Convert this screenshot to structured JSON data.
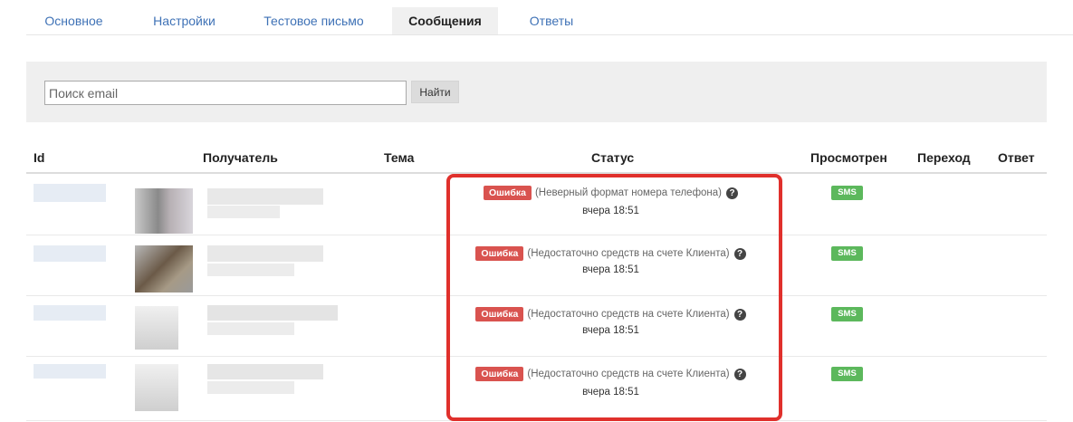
{
  "tabs": [
    {
      "label": "Основное"
    },
    {
      "label": "Настройки"
    },
    {
      "label": "Тестовое письмо"
    },
    {
      "label": "Сообщения",
      "active": true
    },
    {
      "label": "Ответы"
    }
  ],
  "search": {
    "placeholder": "Поиск email",
    "value": "",
    "button_label": "Найти"
  },
  "table": {
    "headers": {
      "id": "Id",
      "recipient": "Получатель",
      "subject": "Тема",
      "status": "Статус",
      "viewed": "Просмотрен",
      "click": "Переход",
      "reply": "Ответ"
    },
    "rows": [
      {
        "error_label": "Ошибка",
        "reason": "(Неверный формат номера телефона)",
        "time": "вчера 18:51",
        "viewed_badge": "SMS"
      },
      {
        "error_label": "Ошибка",
        "reason": "(Недостаточно средств на счете Клиента)",
        "time": "вчера 18:51",
        "viewed_badge": "SMS"
      },
      {
        "error_label": "Ошибка",
        "reason": "(Недостаточно средств на счете Клиента)",
        "time": "вчера 18:51",
        "viewed_badge": "SMS"
      },
      {
        "error_label": "Ошибка",
        "reason": "(Недостаточно средств на счете Клиента)",
        "time": "вчера 18:51",
        "viewed_badge": "SMS"
      }
    ]
  },
  "icons": {
    "help": "question-circle-icon"
  },
  "colors": {
    "error": "#d9534f",
    "success": "#5cb85c",
    "link": "#3f72b6",
    "highlight": "#e0302c"
  }
}
